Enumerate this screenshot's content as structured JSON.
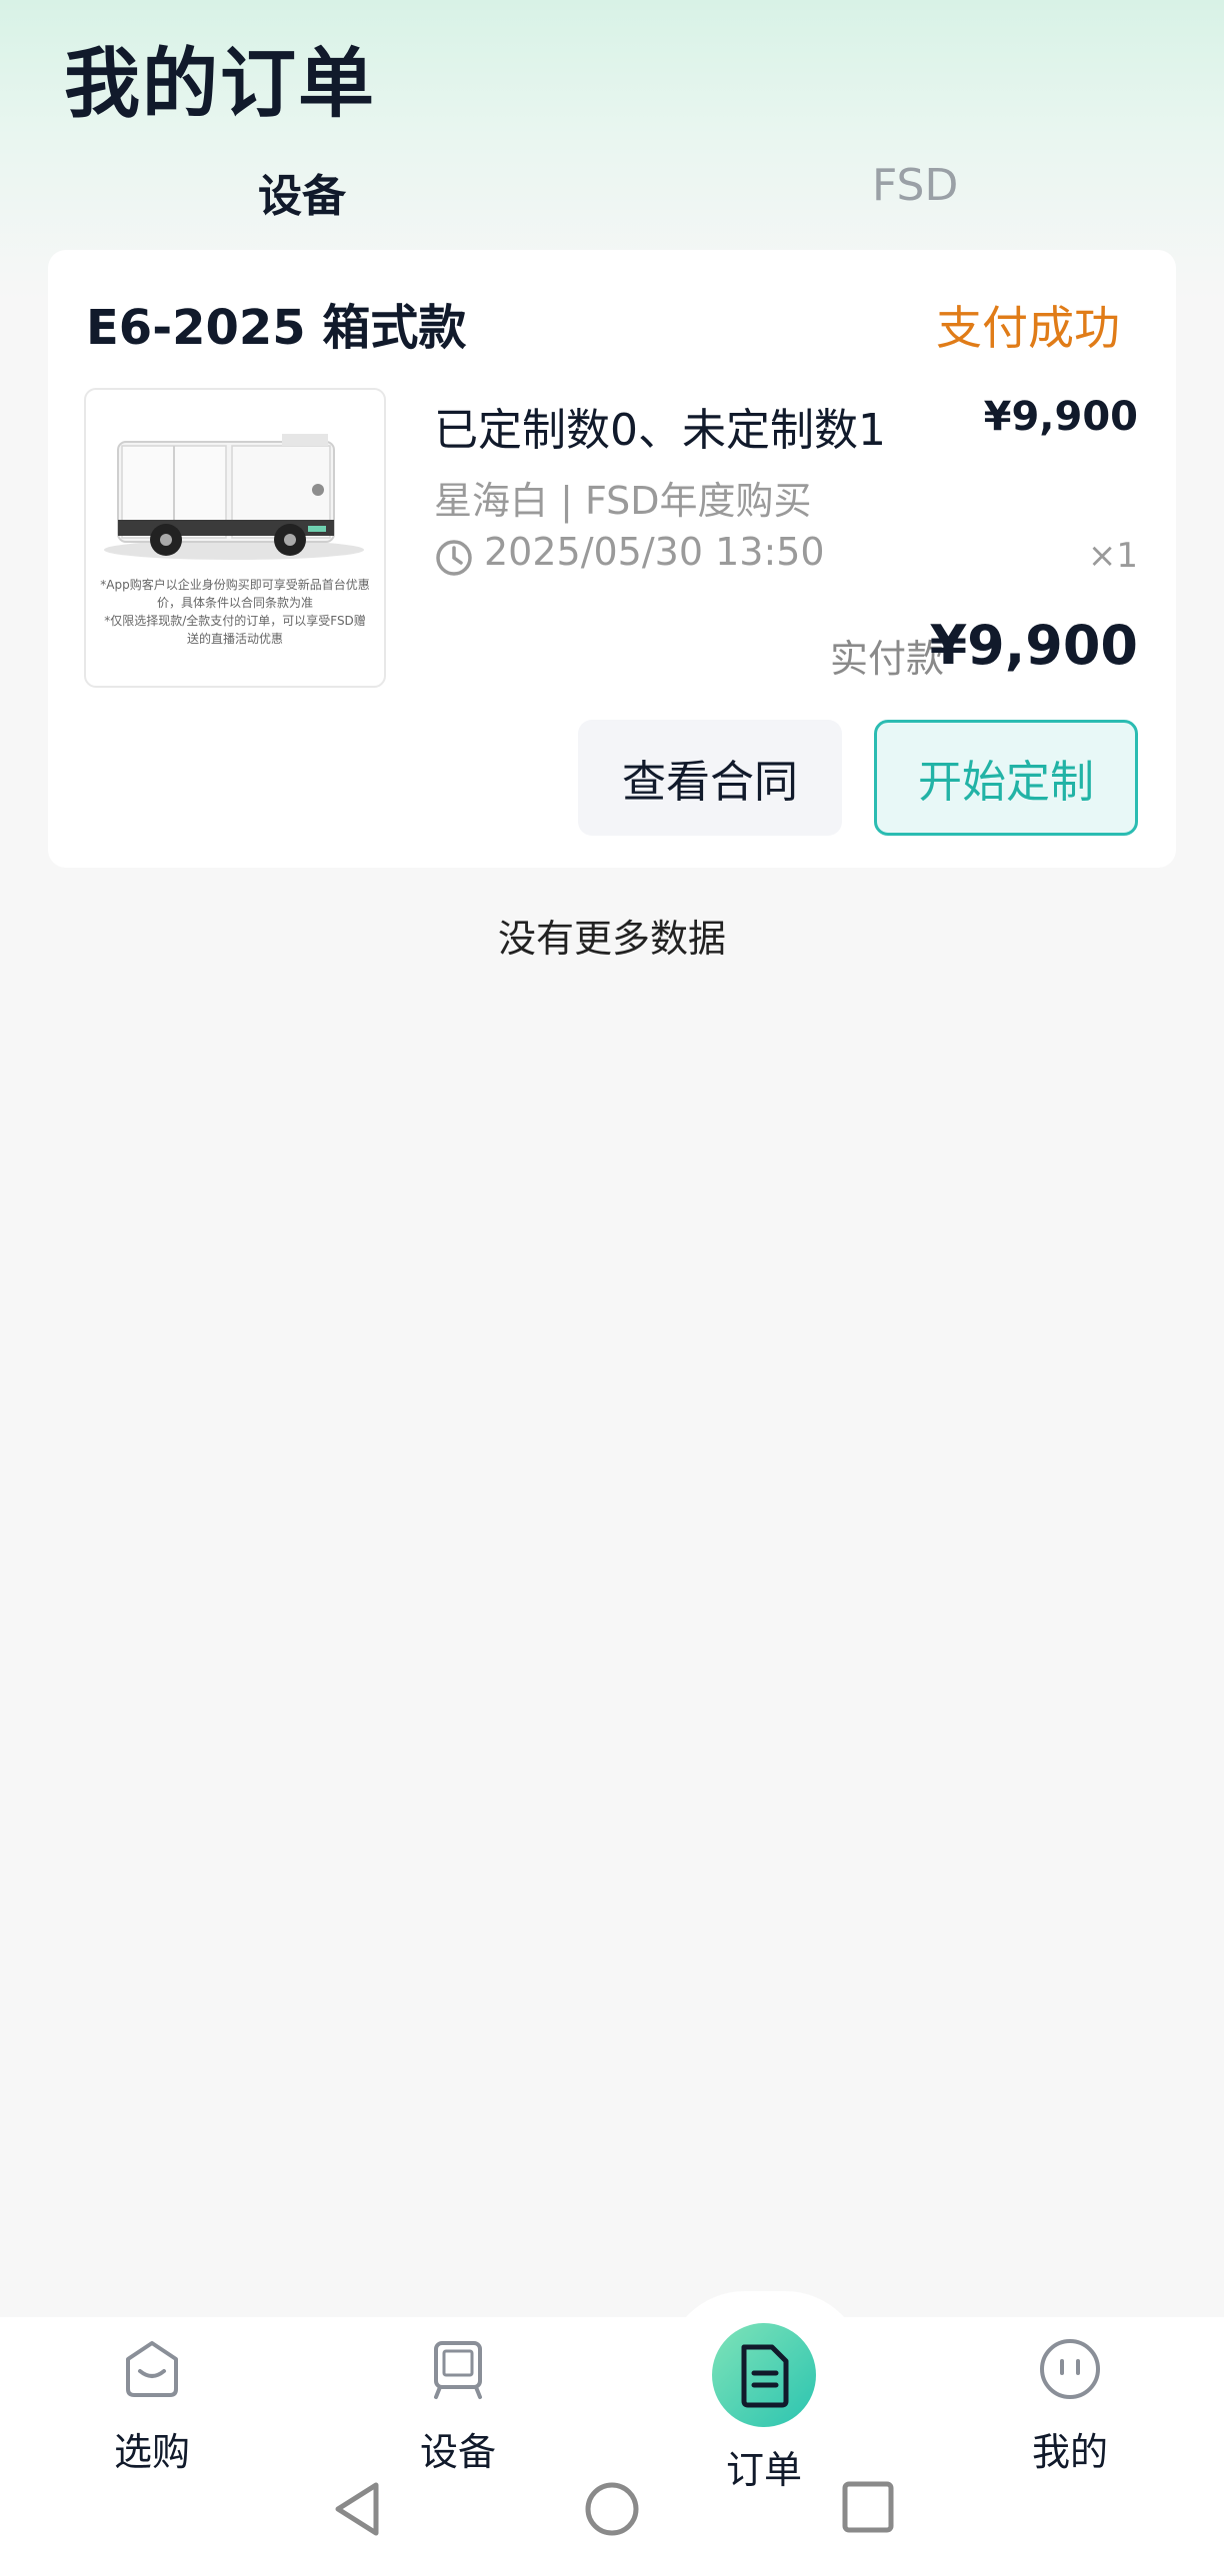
{
  "header": {
    "title": "我的订单"
  },
  "tabs": [
    {
      "label": "设备",
      "active": true
    },
    {
      "label": "FSD",
      "active": false
    }
  ],
  "order": {
    "model": "E6-2025 箱式款",
    "status": "支付成功",
    "image_caption_1": "*App购客户以企业身份购买即可享受新品首台优惠价，具体条件以合同条款为准",
    "image_caption_2": "*仅限选择现款/全款支付的订单，可以享受FSD赠送的直播活动优惠",
    "custom_status": "已定制数0、未定制数1",
    "unit_price": "¥9,900",
    "variant": "星海白 | FSD年度购买",
    "time": "2025/05/30 13:50",
    "quantity": "×1",
    "paid_label": "实付款",
    "paid_amount": "¥9,900",
    "btn_contract": "查看合同",
    "btn_customize": "开始定制"
  },
  "list_end": "没有更多数据",
  "bottom_nav": [
    {
      "label": "选购",
      "icon": "shop-bag-icon"
    },
    {
      "label": "设备",
      "icon": "device-icon"
    },
    {
      "label": "订单",
      "icon": "order-document-icon",
      "active": true
    },
    {
      "label": "我的",
      "icon": "profile-face-icon"
    }
  ],
  "colors": {
    "status": "#e07c18",
    "accent": "#22b3a6",
    "text": "#111a2b"
  }
}
